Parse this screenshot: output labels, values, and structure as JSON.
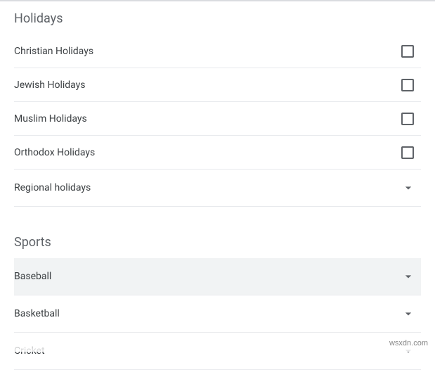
{
  "sections": {
    "holidays": {
      "title": "Holidays",
      "items": [
        {
          "label": "Christian Holidays",
          "type": "checkbox",
          "checked": false
        },
        {
          "label": "Jewish Holidays",
          "type": "checkbox",
          "checked": false
        },
        {
          "label": "Muslim Holidays",
          "type": "checkbox",
          "checked": false
        },
        {
          "label": "Orthodox Holidays",
          "type": "checkbox",
          "checked": false
        },
        {
          "label": "Regional holidays",
          "type": "expand"
        }
      ]
    },
    "sports": {
      "title": "Sports",
      "items": [
        {
          "label": "Baseball",
          "type": "expand",
          "highlighted": true
        },
        {
          "label": "Basketball",
          "type": "expand"
        },
        {
          "label": "Cricket",
          "type": "expand"
        }
      ]
    }
  },
  "watermark": "wsxdn.com"
}
